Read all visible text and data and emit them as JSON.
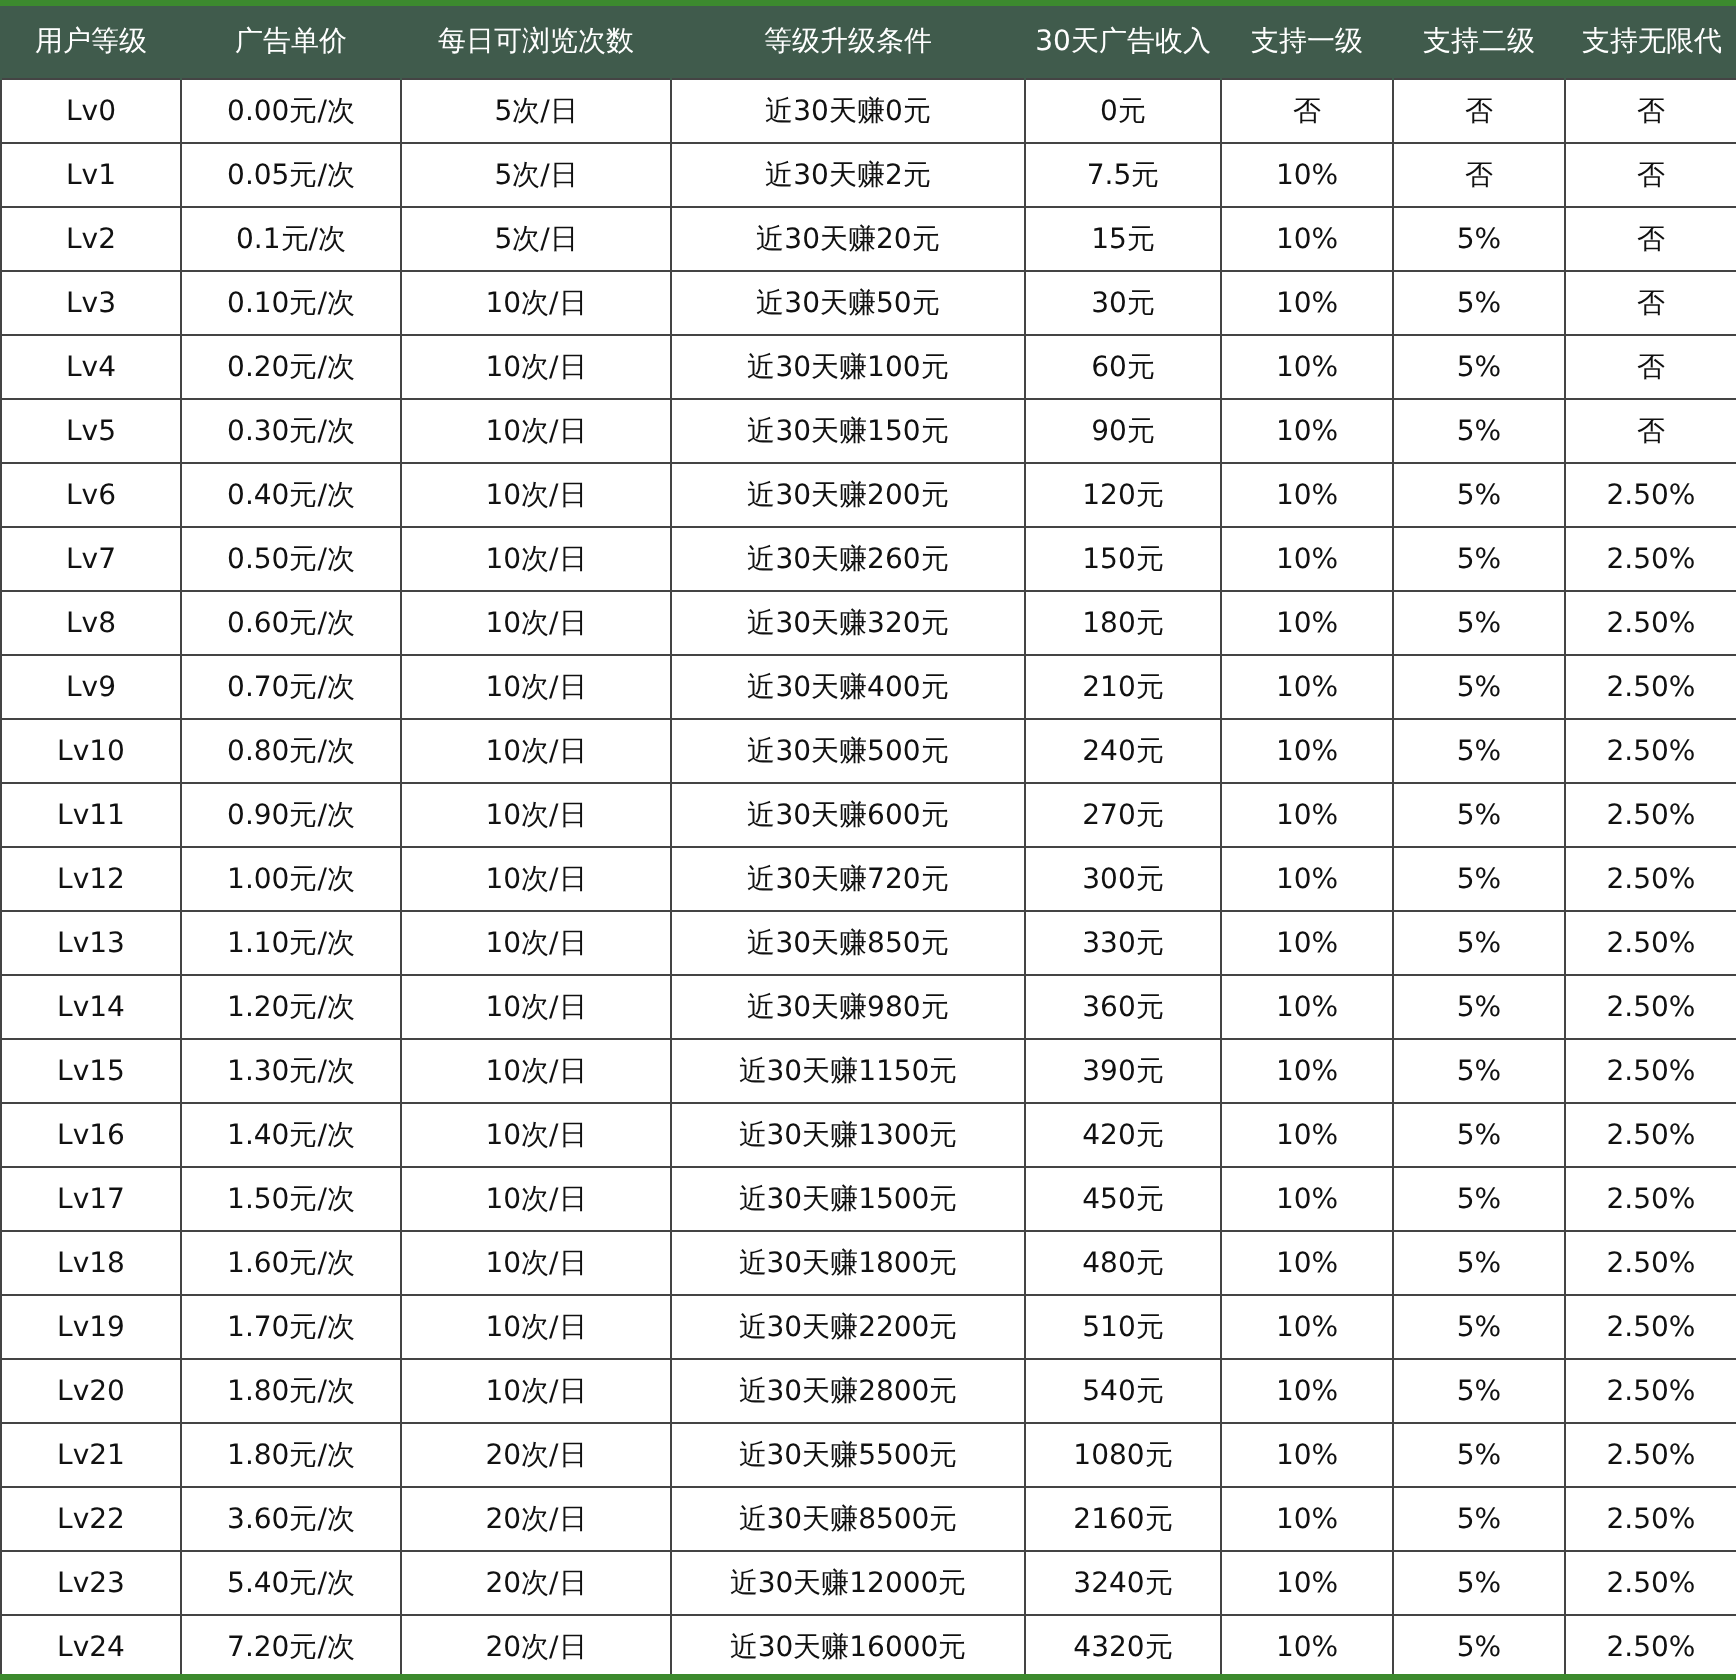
{
  "table": {
    "columns": [
      "用户等级",
      "广告单价",
      "每日可浏览次数",
      "等级升级条件",
      "30天广告收入",
      "支持一级",
      "支持二级",
      "支持无限代"
    ],
    "rows": [
      [
        "Lv0",
        "0.00元/次",
        "5次/日",
        "近30天赚0元",
        "0元",
        "否",
        "否",
        "否"
      ],
      [
        "Lv1",
        "0.05元/次",
        "5次/日",
        "近30天赚2元",
        "7.5元",
        "10%",
        "否",
        "否"
      ],
      [
        "Lv2",
        "0.1元/次",
        "5次/日",
        "近30天赚20元",
        "15元",
        "10%",
        "5%",
        "否"
      ],
      [
        "Lv3",
        "0.10元/次",
        "10次/日",
        "近30天赚50元",
        "30元",
        "10%",
        "5%",
        "否"
      ],
      [
        "Lv4",
        "0.20元/次",
        "10次/日",
        "近30天赚100元",
        "60元",
        "10%",
        "5%",
        "否"
      ],
      [
        "Lv5",
        "0.30元/次",
        "10次/日",
        "近30天赚150元",
        "90元",
        "10%",
        "5%",
        "否"
      ],
      [
        "Lv6",
        "0.40元/次",
        "10次/日",
        "近30天赚200元",
        "120元",
        "10%",
        "5%",
        "2.50%"
      ],
      [
        "Lv7",
        "0.50元/次",
        "10次/日",
        "近30天赚260元",
        "150元",
        "10%",
        "5%",
        "2.50%"
      ],
      [
        "Lv8",
        "0.60元/次",
        "10次/日",
        "近30天赚320元",
        "180元",
        "10%",
        "5%",
        "2.50%"
      ],
      [
        "Lv9",
        "0.70元/次",
        "10次/日",
        "近30天赚400元",
        "210元",
        "10%",
        "5%",
        "2.50%"
      ],
      [
        "Lv10",
        "0.80元/次",
        "10次/日",
        "近30天赚500元",
        "240元",
        "10%",
        "5%",
        "2.50%"
      ],
      [
        "Lv11",
        "0.90元/次",
        "10次/日",
        "近30天赚600元",
        "270元",
        "10%",
        "5%",
        "2.50%"
      ],
      [
        "Lv12",
        "1.00元/次",
        "10次/日",
        "近30天赚720元",
        "300元",
        "10%",
        "5%",
        "2.50%"
      ],
      [
        "Lv13",
        "1.10元/次",
        "10次/日",
        "近30天赚850元",
        "330元",
        "10%",
        "5%",
        "2.50%"
      ],
      [
        "Lv14",
        "1.20元/次",
        "10次/日",
        "近30天赚980元",
        "360元",
        "10%",
        "5%",
        "2.50%"
      ],
      [
        "Lv15",
        "1.30元/次",
        "10次/日",
        "近30天赚1150元",
        "390元",
        "10%",
        "5%",
        "2.50%"
      ],
      [
        "Lv16",
        "1.40元/次",
        "10次/日",
        "近30天赚1300元",
        "420元",
        "10%",
        "5%",
        "2.50%"
      ],
      [
        "Lv17",
        "1.50元/次",
        "10次/日",
        "近30天赚1500元",
        "450元",
        "10%",
        "5%",
        "2.50%"
      ],
      [
        "Lv18",
        "1.60元/次",
        "10次/日",
        "近30天赚1800元",
        "480元",
        "10%",
        "5%",
        "2.50%"
      ],
      [
        "Lv19",
        "1.70元/次",
        "10次/日",
        "近30天赚2200元",
        "510元",
        "10%",
        "5%",
        "2.50%"
      ],
      [
        "Lv20",
        "1.80元/次",
        "10次/日",
        "近30天赚2800元",
        "540元",
        "10%",
        "5%",
        "2.50%"
      ],
      [
        "Lv21",
        "1.80元/次",
        "20次/日",
        "近30天赚5500元",
        "1080元",
        "10%",
        "5%",
        "2.50%"
      ],
      [
        "Lv22",
        "3.60元/次",
        "20次/日",
        "近30天赚8500元",
        "2160元",
        "10%",
        "5%",
        "2.50%"
      ],
      [
        "Lv23",
        "5.40元/次",
        "20次/日",
        "近30天赚12000元",
        "3240元",
        "10%",
        "5%",
        "2.50%"
      ],
      [
        "Lv24",
        "7.20元/次",
        "20次/日",
        "近30天赚16000元",
        "4320元",
        "10%",
        "5%",
        "2.50%"
      ]
    ]
  }
}
